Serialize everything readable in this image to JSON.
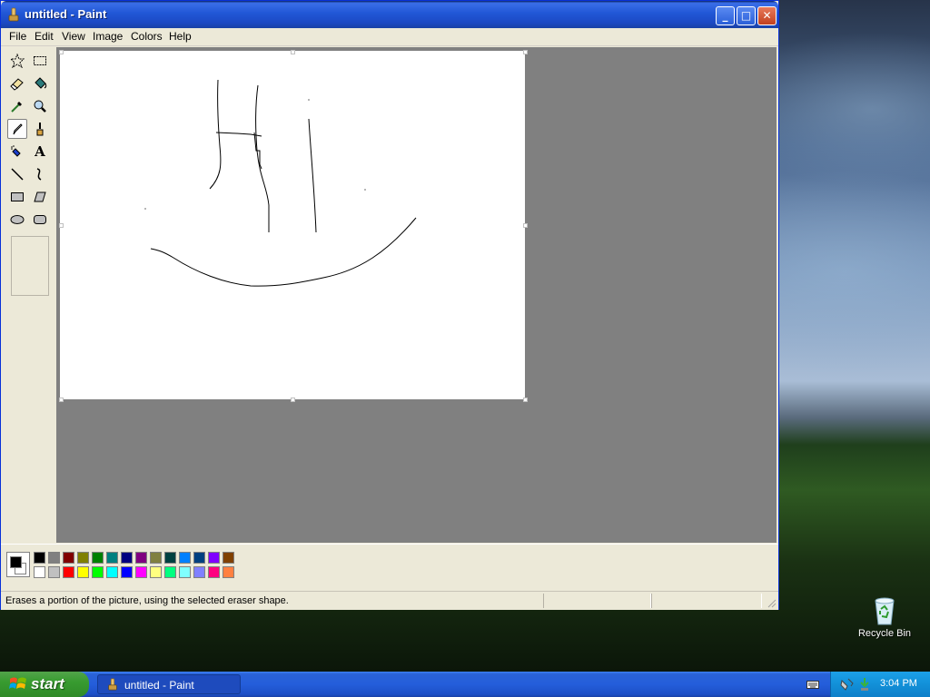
{
  "window": {
    "title": "untitled - Paint",
    "controls": {
      "minimize": "_",
      "maximize": "□",
      "close": "✕"
    }
  },
  "menu": [
    "File",
    "Edit",
    "View",
    "Image",
    "Colors",
    "Help"
  ],
  "tools": [
    {
      "name": "free-form-select-icon"
    },
    {
      "name": "select-icon"
    },
    {
      "name": "eraser-icon",
      "selected": false
    },
    {
      "name": "fill-with-color-icon"
    },
    {
      "name": "pick-color-icon"
    },
    {
      "name": "magnifier-icon"
    },
    {
      "name": "pencil-icon",
      "selected": true
    },
    {
      "name": "brush-icon"
    },
    {
      "name": "airbrush-icon"
    },
    {
      "name": "text-icon",
      "glyph": "A"
    },
    {
      "name": "line-icon"
    },
    {
      "name": "curve-icon"
    },
    {
      "name": "rectangle-icon"
    },
    {
      "name": "polygon-icon"
    },
    {
      "name": "ellipse-icon"
    },
    {
      "name": "rounded-rectangle-icon"
    }
  ],
  "palette": {
    "foreground": "#000000",
    "background": "#ffffff",
    "top_row": [
      "#000000",
      "#808080",
      "#800000",
      "#808000",
      "#008000",
      "#008080",
      "#000080",
      "#800080",
      "#808040",
      "#004040",
      "#0080ff",
      "#004080",
      "#8000ff",
      "#804000"
    ],
    "bottom_row": [
      "#ffffff",
      "#c0c0c0",
      "#ff0000",
      "#ffff00",
      "#00ff00",
      "#00ffff",
      "#0000ff",
      "#ff00ff",
      "#ffff80",
      "#00ff80",
      "#80ffff",
      "#8080ff",
      "#ff0080",
      "#ff8040"
    ]
  },
  "status": {
    "message": "Erases a portion of the picture, using the selected eraser shape."
  },
  "desktop": {
    "recycle_bin_label": "Recycle Bin"
  },
  "taskbar": {
    "start_label": "start",
    "task_label": "untitled - Paint",
    "clock": "3:04 PM"
  }
}
